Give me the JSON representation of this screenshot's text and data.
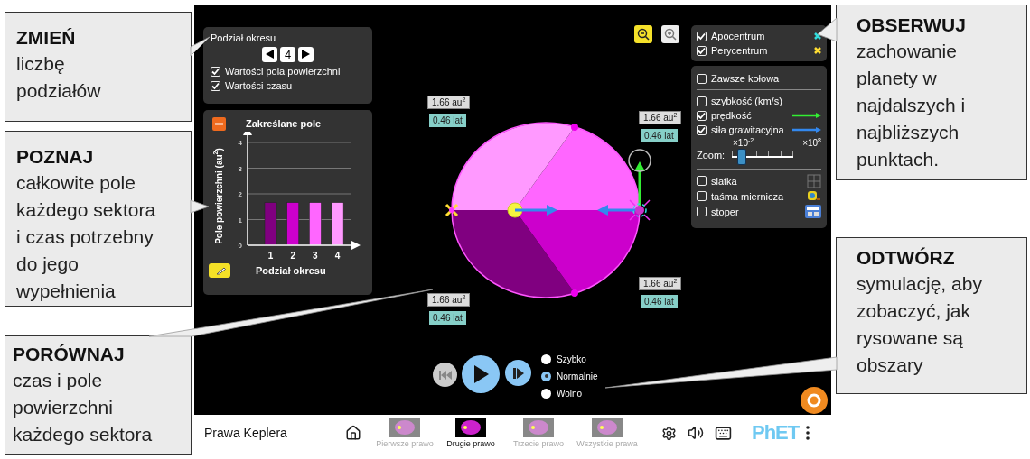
{
  "callouts": [
    {
      "title": "ZMIEŃ",
      "lines": [
        "liczbę",
        "podziałów"
      ]
    },
    {
      "title": "POZNAJ",
      "lines": [
        "całkowite pole",
        "każdego sektora",
        "i czas potrzebny",
        "do jego",
        "wypełnienia"
      ]
    },
    {
      "title": "PORÓWNAJ",
      "lines": [
        "czas i pole",
        "powierzchni",
        "każdego sektora"
      ]
    },
    {
      "title": "OBSERWUJ",
      "lines": [
        "zachowanie",
        "planety w",
        "najdalszych i",
        "najbliższych",
        "punktach."
      ]
    },
    {
      "title": "ODTWÓRZ",
      "lines": [
        "symulację, aby",
        "zobaczyć, jak",
        "rysowane są",
        "obszary"
      ]
    }
  ],
  "sim": {
    "divisions_panel": {
      "label": "Podział okresu",
      "value": "4",
      "checkboxes": [
        {
          "label": "Wartości pola powierzchni",
          "checked": true
        },
        {
          "label": "Wartości czasu",
          "checked": true
        }
      ]
    },
    "area_panel": {
      "expanded": true,
      "chart_data": {
        "type": "bar",
        "grid": true,
        "title": "Zakreślane pole",
        "xlabel": "Podział okresu",
        "ylabel": "Pole powierzchni (au$^{2}$)",
        "categories": [
          "1",
          "2",
          "3",
          "4"
        ],
        "values": [
          1.66,
          1.66,
          1.66,
          1.66
        ],
        "ylim": [
          0,
          4
        ],
        "yticks": [
          0,
          1,
          2,
          3,
          4
        ]
      }
    },
    "markers_panel": [
      {
        "label": "Apocentrum",
        "checked": true,
        "color": "#33dddd"
      },
      {
        "label": "Perycentrum",
        "checked": true,
        "color": "#ffdd33"
      }
    ],
    "options_panel": {
      "circular": {
        "label": "Zawsze kołowa",
        "checked": false
      },
      "vectors": [
        {
          "label": "szybkość (km/s)",
          "checked": false,
          "kind": "plain"
        },
        {
          "label": "prędkość",
          "checked": true,
          "kind": "arrow",
          "color": "#33ee33"
        },
        {
          "label": "siła grawitacyjna",
          "checked": true,
          "kind": "arrow",
          "color": "#3388ee"
        }
      ],
      "zoom": {
        "label": "Zoom:",
        "min": "×10$^{-2}$",
        "max": "×10$^{8}$",
        "level": 0.15
      },
      "tools": [
        {
          "label": "siatka",
          "checked": false,
          "kind": "grid"
        },
        {
          "label": "taśma miernicza",
          "checked": false,
          "kind": "tape"
        },
        {
          "label": "stoper",
          "checked": false,
          "kind": "stopwatch"
        }
      ]
    },
    "sector_labels": [
      {
        "area": "1.66 au$^{2}$",
        "time": "0.46 lat"
      },
      {
        "area": "1.66 au$^{2}$",
        "time": "0.46 lat"
      },
      {
        "area": "1.66 au$^{2}$",
        "time": "0.46 lat"
      },
      {
        "area": "1.66 au$^{2}$",
        "time": "0.46 lat"
      }
    ],
    "playing": false,
    "speeds": [
      {
        "label": "Szybko",
        "selected": false
      },
      {
        "label": "Normalnie",
        "selected": true
      },
      {
        "label": "Wolno",
        "selected": false
      }
    ]
  },
  "navbar": {
    "title": "Prawa Keplera",
    "screens": [
      {
        "label": "Pierwsze prawo",
        "selected": false
      },
      {
        "label": "Drugie prawo",
        "selected": true
      },
      {
        "label": "Trzecie prawo",
        "selected": false
      },
      {
        "label": "Wszystkie prawa",
        "selected": false
      }
    ],
    "logo": "PhET"
  }
}
